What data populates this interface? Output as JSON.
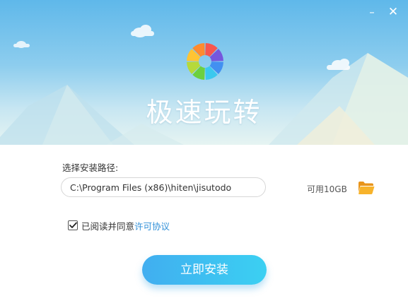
{
  "window": {
    "minimize_glyph": "–",
    "close_glyph": "✕"
  },
  "app": {
    "title": "极速玩转",
    "logo_icon": "color-wheel-logo",
    "logo_colors": [
      "#f7564e",
      "#7657dd",
      "#4290f1",
      "#3bc8ee",
      "#6cd03f",
      "#b6d93a",
      "#ffc433",
      "#ff8b2e"
    ]
  },
  "install": {
    "path_label": "选择安装路径:",
    "path_value": "C:\\Program Files (x86)\\hiten\\jisutodo",
    "available_space": "可用10GB",
    "folder_icon": "folder-icon",
    "agree_checked": true,
    "agree_text": "已阅读并同意",
    "agree_link": "许可协议",
    "install_button": "立即安装"
  },
  "colors": {
    "accent": "#3bb8ee",
    "link": "#2f8fd8",
    "folder": "#f5a623"
  }
}
